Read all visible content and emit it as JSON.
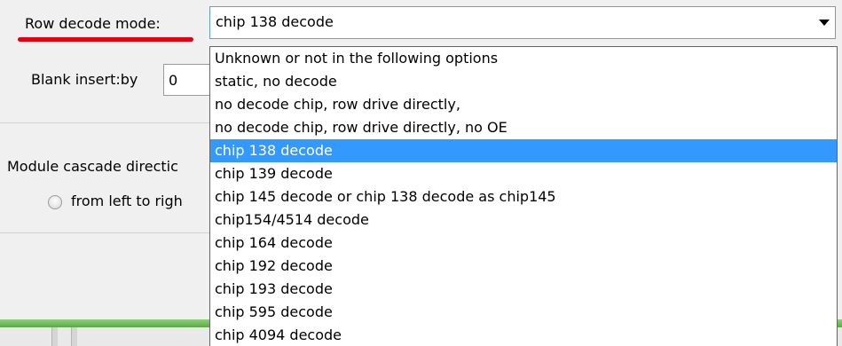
{
  "form": {
    "row_decode_label": "Row decode mode:",
    "blank_insert_label": "Blank insert:by",
    "blank_insert_value": "0",
    "cascade_label": "Module cascade directic",
    "radio_label": "from left to righ"
  },
  "combo": {
    "selected_value": "chip 138 decode",
    "options": [
      "Unknown or not in the following options",
      "static, no decode",
      "no decode chip, row drive directly,",
      "no decode chip, row drive directly, no OE",
      "chip 138 decode",
      "chip 139 decode",
      "chip 145 decode or chip 138 decode as chip145",
      "chip154/4514 decode",
      "chip 164 decode",
      "chip 192 decode",
      "chip 193 decode",
      "chip 595 decode",
      "chip 4094 decode"
    ],
    "highlighted_index": 4
  },
  "colors": {
    "highlight": "#3399ff",
    "underline": "#e3000f",
    "progress_green": "#6cbf55"
  }
}
